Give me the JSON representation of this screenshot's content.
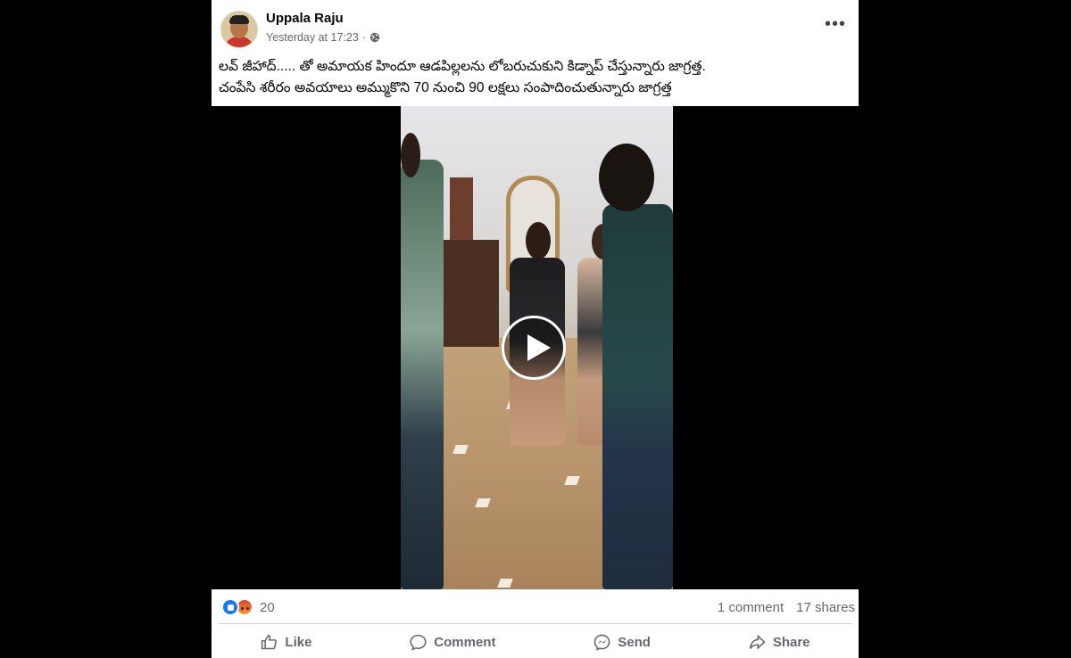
{
  "post": {
    "author": "Uppala Raju",
    "timestamp": "Yesterday at 17:23",
    "privacy_icon": "globe-icon",
    "text": "లవ్ జీహాద్..... తో అమాయక హిందూ ఆడపిల్లలను లోబరుచుకుని కిడ్నాప్ చేస్తున్నారు జాగ్రత్త.\nచంపేసి శరీరం అవయాలు అమ్ముకొని 70 నుంచి 90 లక్షలు సంపాదించుతున్నారు జాగ్రత్త"
  },
  "reactions": {
    "icons": [
      "like-reaction-icon",
      "angry-reaction-icon"
    ],
    "count": "20",
    "comments": "1 comment",
    "shares": "17 shares"
  },
  "actions": {
    "like": "Like",
    "comment": "Comment",
    "send": "Send",
    "share": "Share"
  },
  "colors": {
    "accent": "#1877f2",
    "secondary_text": "#65676b",
    "background": "#000000"
  }
}
